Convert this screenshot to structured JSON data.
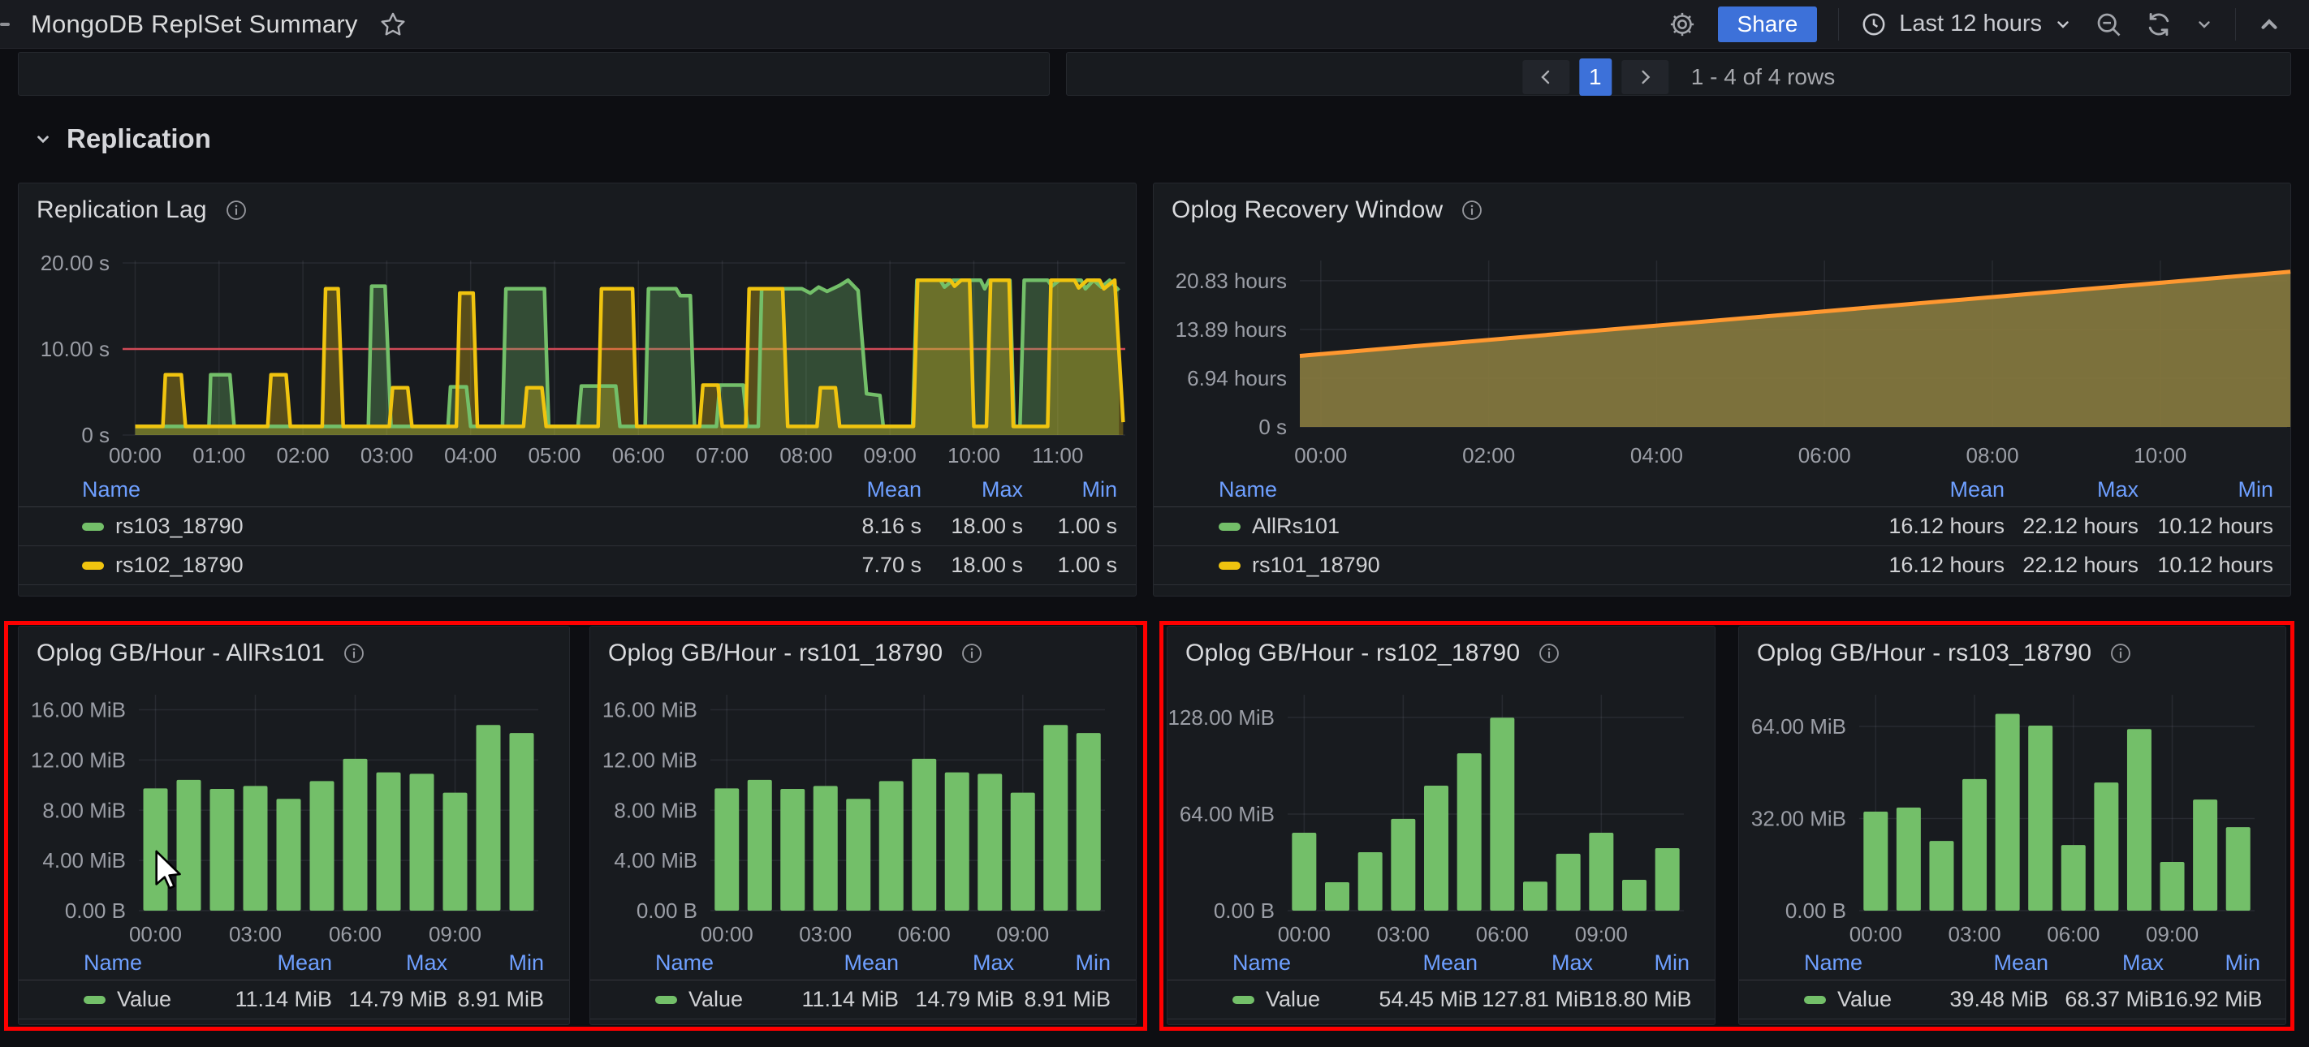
{
  "header": {
    "title": "MongoDB ReplSet Summary",
    "share_label": "Share",
    "time_range_label": "Last 12 hours"
  },
  "toprow_pagination": {
    "current_page": "1",
    "summary": "1 - 4 of 4 rows"
  },
  "section": {
    "title": "Replication"
  },
  "panels": {
    "lag": {
      "title": "Replication Lag"
    },
    "recovery": {
      "title": "Oplog Recovery Window"
    },
    "bars": [
      {
        "title": "Oplog GB/Hour - AllRs101"
      },
      {
        "title": "Oplog GB/Hour - rs101_18790"
      },
      {
        "title": "Oplog GB/Hour - rs102_18790"
      },
      {
        "title": "Oplog GB/Hour - rs103_18790"
      }
    ]
  },
  "colors": {
    "green": "#73bf69",
    "yellow": "#f0c40f",
    "orange": "#ff9830",
    "olive_fill": "#85783f",
    "threshold_red": "#d04a57",
    "accent_blue": "#3d71d9",
    "link_blue": "#6e9fff",
    "highlight_red": "#fe0000"
  },
  "chart_data": [
    {
      "id": "replication_lag",
      "type": "line",
      "title": "Replication Lag",
      "ylim": [
        0,
        20.3
      ],
      "yticks": [
        {
          "value": 0,
          "label": "0 s"
        },
        {
          "value": 10,
          "label": "10.00 s"
        },
        {
          "value": 20,
          "label": "20.00 s"
        }
      ],
      "xticks": [
        {
          "hour": 0,
          "label": "00:00"
        },
        {
          "hour": 1,
          "label": "01:00"
        },
        {
          "hour": 2,
          "label": "02:00"
        },
        {
          "hour": 3,
          "label": "03:00"
        },
        {
          "hour": 4,
          "label": "04:00"
        },
        {
          "hour": 5,
          "label": "05:00"
        },
        {
          "hour": 6,
          "label": "06:00"
        },
        {
          "hour": 7,
          "label": "07:00"
        },
        {
          "hour": 8,
          "label": "08:00"
        },
        {
          "hour": 9,
          "label": "09:00"
        },
        {
          "hour": 10,
          "label": "10:00"
        },
        {
          "hour": 11,
          "label": "11:00"
        }
      ],
      "threshold": {
        "value": 10
      },
      "render_mode": "multi",
      "fill_opacity": 0.3,
      "series": [
        {
          "name": "rs103_18790",
          "color": "#73bf69",
          "points": [
            [
              0,
              1
            ],
            [
              0.88,
              1
            ],
            [
              0.9,
              7
            ],
            [
              1.13,
              7
            ],
            [
              1.18,
              1
            ],
            [
              2.78,
              1
            ],
            [
              2.82,
              17.3
            ],
            [
              2.98,
              17.3
            ],
            [
              3.05,
              1
            ],
            [
              3.73,
              1
            ],
            [
              3.76,
              5.6
            ],
            [
              3.95,
              5.6
            ],
            [
              4.0,
              1
            ],
            [
              4.38,
              1
            ],
            [
              4.42,
              17
            ],
            [
              4.88,
              17
            ],
            [
              4.93,
              1
            ],
            [
              5.28,
              1
            ],
            [
              5.32,
              5.7
            ],
            [
              5.73,
              5.7
            ],
            [
              5.78,
              1
            ],
            [
              6.08,
              1
            ],
            [
              6.12,
              17
            ],
            [
              6.45,
              17
            ],
            [
              6.5,
              16.2
            ],
            [
              6.62,
              16.2
            ],
            [
              6.67,
              1
            ],
            [
              6.93,
              1
            ],
            [
              6.97,
              5.8
            ],
            [
              7.25,
              5.8
            ],
            [
              7.3,
              1
            ],
            [
              7.43,
              1
            ],
            [
              7.47,
              17
            ],
            [
              7.95,
              17
            ],
            [
              8.05,
              16.5
            ],
            [
              8.15,
              17.2
            ],
            [
              8.25,
              16.7
            ],
            [
              8.4,
              17.4
            ],
            [
              8.5,
              18
            ],
            [
              8.62,
              16.8
            ],
            [
              8.72,
              4.8
            ],
            [
              8.88,
              4.6
            ],
            [
              8.92,
              1
            ],
            [
              9.27,
              1
            ],
            [
              9.32,
              18
            ],
            [
              9.6,
              18
            ],
            [
              9.65,
              17.2
            ],
            [
              9.75,
              18
            ],
            [
              10.08,
              18
            ],
            [
              10.13,
              17
            ],
            [
              10.18,
              18
            ],
            [
              10.43,
              18
            ],
            [
              10.48,
              1
            ],
            [
              10.55,
              1
            ],
            [
              10.6,
              18
            ],
            [
              10.88,
              18
            ],
            [
              10.93,
              17.3
            ],
            [
              11.02,
              18
            ],
            [
              11.28,
              18
            ],
            [
              11.33,
              17
            ],
            [
              11.43,
              18
            ],
            [
              11.52,
              17.2
            ],
            [
              11.62,
              18
            ],
            [
              11.73,
              16.8
            ]
          ]
        },
        {
          "name": "rs102_18790",
          "color": "#f0c40f",
          "points": [
            [
              0,
              1
            ],
            [
              0.33,
              1
            ],
            [
              0.36,
              7
            ],
            [
              0.55,
              7
            ],
            [
              0.6,
              1
            ],
            [
              1.58,
              1
            ],
            [
              1.62,
              7
            ],
            [
              1.8,
              7
            ],
            [
              1.85,
              1
            ],
            [
              2.23,
              1
            ],
            [
              2.27,
              17
            ],
            [
              2.42,
              17
            ],
            [
              2.48,
              1
            ],
            [
              3.03,
              1
            ],
            [
              3.07,
              5.5
            ],
            [
              3.25,
              5.5
            ],
            [
              3.3,
              1
            ],
            [
              3.83,
              1
            ],
            [
              3.87,
              16.5
            ],
            [
              4.03,
              16.5
            ],
            [
              4.08,
              1
            ],
            [
              4.63,
              1
            ],
            [
              4.67,
              5.5
            ],
            [
              4.85,
              5.5
            ],
            [
              4.9,
              1
            ],
            [
              5.52,
              1
            ],
            [
              5.56,
              17
            ],
            [
              5.93,
              17
            ],
            [
              5.98,
              1
            ],
            [
              6.73,
              1
            ],
            [
              6.77,
              5.8
            ],
            [
              6.95,
              5.8
            ],
            [
              7.0,
              1
            ],
            [
              7.28,
              1
            ],
            [
              7.32,
              17
            ],
            [
              7.72,
              17
            ],
            [
              7.78,
              1
            ],
            [
              8.13,
              1
            ],
            [
              8.17,
              5.5
            ],
            [
              8.35,
              5.5
            ],
            [
              8.4,
              1
            ],
            [
              9.28,
              1
            ],
            [
              9.33,
              18
            ],
            [
              9.72,
              18
            ],
            [
              9.77,
              17.3
            ],
            [
              9.85,
              18
            ],
            [
              9.95,
              18
            ],
            [
              10.0,
              1
            ],
            [
              10.15,
              1
            ],
            [
              10.2,
              18
            ],
            [
              10.42,
              18
            ],
            [
              10.47,
              1
            ],
            [
              10.88,
              1
            ],
            [
              10.92,
              18
            ],
            [
              11.2,
              18
            ],
            [
              11.25,
              17.1
            ],
            [
              11.35,
              18
            ],
            [
              11.5,
              18
            ],
            [
              11.55,
              17
            ],
            [
              11.68,
              18
            ],
            [
              11.78,
              1.5
            ]
          ]
        }
      ],
      "legend": {
        "headers": [
          "Name",
          "Mean",
          "Max",
          "Min"
        ],
        "rows": [
          {
            "name": "rs103_18790",
            "color": "#73bf69",
            "mean": "8.16 s",
            "max": "18.00 s",
            "min": "1.00 s"
          },
          {
            "name": "rs102_18790",
            "color": "#f0c40f",
            "mean": "7.70 s",
            "max": "18.00 s",
            "min": "1.00 s"
          }
        ]
      }
    },
    {
      "id": "oplog_recovery_window",
      "type": "area",
      "title": "Oplog Recovery Window",
      "ylim": [
        0,
        23.6
      ],
      "yticks": [
        {
          "value": 0,
          "label": "0 s"
        },
        {
          "value": 6.94,
          "label": "6.94 hours"
        },
        {
          "value": 13.89,
          "label": "13.89 hours"
        },
        {
          "value": 20.83,
          "label": "20.83 hours"
        }
      ],
      "xticks": [
        {
          "hour": 0,
          "label": "00:00"
        },
        {
          "hour": 2,
          "label": "02:00"
        },
        {
          "hour": 4,
          "label": "04:00"
        },
        {
          "hour": 6,
          "label": "06:00"
        },
        {
          "hour": 8,
          "label": "08:00"
        },
        {
          "hour": 10,
          "label": "10:00"
        }
      ],
      "render_mode": "single",
      "display_fill": "#85783f",
      "display_line": "#ff9830",
      "series": [
        {
          "name": "AllRs101",
          "color": "#73bf69",
          "points": [
            [
              -0.25,
              10.12
            ],
            [
              11.55,
              22.12
            ]
          ]
        },
        {
          "name": "rs101_18790",
          "color": "#f0c40f",
          "points": [
            [
              -0.25,
              10.12
            ],
            [
              11.55,
              22.12
            ]
          ]
        }
      ],
      "legend": {
        "headers": [
          "Name",
          "Mean",
          "Max",
          "Min"
        ],
        "rows": [
          {
            "name": "AllRs101",
            "color": "#73bf69",
            "mean": "16.12 hours",
            "max": "22.12 hours",
            "min": "10.12 hours"
          },
          {
            "name": "rs101_18790",
            "color": "#f0c40f",
            "mean": "16.12 hours",
            "max": "22.12 hours",
            "min": "10.12 hours"
          }
        ]
      }
    },
    {
      "id": "oplog_allrs101",
      "type": "bar",
      "title": "Oplog GB/Hour - AllRs101",
      "bar_color": "#73bf69",
      "categories": [
        "00:00",
        "01:00",
        "02:00",
        "03:00",
        "04:00",
        "05:00",
        "06:00",
        "07:00",
        "08:00",
        "09:00",
        "10:00",
        "11:00"
      ],
      "values": [
        9.74,
        10.42,
        9.7,
        9.93,
        8.91,
        10.32,
        12.1,
        11.02,
        10.9,
        9.4,
        14.79,
        14.15
      ],
      "unit": "MiB",
      "ylim": [
        0,
        17.2
      ],
      "yticks": [
        {
          "value": 0,
          "label": "0.00 B"
        },
        {
          "value": 4,
          "label": "4.00 MiB"
        },
        {
          "value": 8,
          "label": "8.00 MiB"
        },
        {
          "value": 12,
          "label": "12.00 MiB"
        },
        {
          "value": 16,
          "label": "16.00 MiB"
        }
      ],
      "xtick_indices": [
        0,
        3,
        6,
        9
      ],
      "xtick_labels": [
        "00:00",
        "03:00",
        "06:00",
        "09:00"
      ],
      "legend": {
        "headers": [
          "Name",
          "Mean",
          "Max",
          "Min"
        ],
        "rows": [
          {
            "name": "Value",
            "color": "#73bf69",
            "mean": "11.14 MiB",
            "max": "14.79 MiB",
            "min": "8.91 MiB"
          }
        ]
      }
    },
    {
      "id": "oplog_rs101",
      "type": "bar",
      "title": "Oplog GB/Hour - rs101_18790",
      "bar_color": "#73bf69",
      "categories": [
        "00:00",
        "01:00",
        "02:00",
        "03:00",
        "04:00",
        "05:00",
        "06:00",
        "07:00",
        "08:00",
        "09:00",
        "10:00",
        "11:00"
      ],
      "values": [
        9.74,
        10.42,
        9.7,
        9.93,
        8.91,
        10.32,
        12.1,
        11.02,
        10.9,
        9.4,
        14.79,
        14.15
      ],
      "unit": "MiB",
      "ylim": [
        0,
        17.2
      ],
      "yticks": [
        {
          "value": 0,
          "label": "0.00 B"
        },
        {
          "value": 4,
          "label": "4.00 MiB"
        },
        {
          "value": 8,
          "label": "8.00 MiB"
        },
        {
          "value": 12,
          "label": "12.00 MiB"
        },
        {
          "value": 16,
          "label": "16.00 MiB"
        }
      ],
      "xtick_indices": [
        0,
        3,
        6,
        9
      ],
      "xtick_labels": [
        "00:00",
        "03:00",
        "06:00",
        "09:00"
      ],
      "legend": {
        "headers": [
          "Name",
          "Mean",
          "Max",
          "Min"
        ],
        "rows": [
          {
            "name": "Value",
            "color": "#73bf69",
            "mean": "11.14 MiB",
            "max": "14.79 MiB",
            "min": "8.91 MiB"
          }
        ]
      }
    },
    {
      "id": "oplog_rs102",
      "type": "bar",
      "title": "Oplog GB/Hour - rs102_18790",
      "bar_color": "#73bf69",
      "categories": [
        "00:00",
        "01:00",
        "02:00",
        "03:00",
        "04:00",
        "05:00",
        "06:00",
        "07:00",
        "08:00",
        "09:00",
        "10:00",
        "11:00"
      ],
      "values": [
        51.6,
        18.8,
        38.7,
        60.8,
        82.8,
        104.2,
        127.81,
        19.2,
        37.7,
        51.6,
        20.4,
        41.4
      ],
      "unit": "MiB",
      "ylim": [
        0,
        143
      ],
      "yticks": [
        {
          "value": 0,
          "label": "0.00 B"
        },
        {
          "value": 64,
          "label": "64.00 MiB"
        },
        {
          "value": 128,
          "label": "128.00 MiB"
        }
      ],
      "xtick_indices": [
        0,
        3,
        6,
        9
      ],
      "xtick_labels": [
        "00:00",
        "03:00",
        "06:00",
        "09:00"
      ],
      "legend": {
        "headers": [
          "Name",
          "Mean",
          "Max",
          "Min"
        ],
        "rows": [
          {
            "name": "Value",
            "color": "#73bf69",
            "mean": "54.45 MiB",
            "max": "127.81 MiB",
            "min": "18.80 MiB"
          }
        ]
      }
    },
    {
      "id": "oplog_rs103",
      "type": "bar",
      "title": "Oplog GB/Hour - rs103_18790",
      "bar_color": "#73bf69",
      "categories": [
        "00:00",
        "01:00",
        "02:00",
        "03:00",
        "04:00",
        "05:00",
        "06:00",
        "07:00",
        "08:00",
        "09:00",
        "10:00",
        "11:00"
      ],
      "values": [
        34.4,
        35.8,
        24.2,
        45.7,
        68.37,
        64.3,
        22.8,
        44.5,
        63.1,
        16.92,
        38.6,
        29.0
      ],
      "unit": "MiB",
      "ylim": [
        0,
        75
      ],
      "yticks": [
        {
          "value": 0,
          "label": "0.00 B"
        },
        {
          "value": 32,
          "label": "32.00 MiB"
        },
        {
          "value": 64,
          "label": "64.00 MiB"
        }
      ],
      "xtick_indices": [
        0,
        3,
        6,
        9
      ],
      "xtick_labels": [
        "00:00",
        "03:00",
        "06:00",
        "09:00"
      ],
      "legend": {
        "headers": [
          "Name",
          "Mean",
          "Max",
          "Min"
        ],
        "rows": [
          {
            "name": "Value",
            "color": "#73bf69",
            "mean": "39.48 MiB",
            "max": "68.37 MiB",
            "min": "16.92 MiB"
          }
        ]
      }
    }
  ]
}
